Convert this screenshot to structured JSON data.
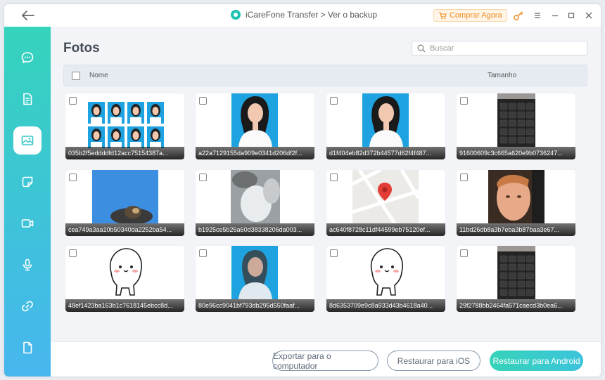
{
  "titlebar": {
    "title": "iCareFone Transfer > Ver o backup",
    "buy_label": "Comprar Agora"
  },
  "page": {
    "title": "Fotos"
  },
  "search": {
    "placeholder": "Buscar",
    "value": ""
  },
  "table": {
    "col_name": "Nome",
    "col_size": "Tamanho"
  },
  "sidebar": {
    "items": [
      {
        "name": "messages-icon"
      },
      {
        "name": "documents-icon"
      },
      {
        "name": "photos-icon",
        "active": true
      },
      {
        "name": "stickers-icon"
      },
      {
        "name": "video-icon"
      },
      {
        "name": "microphone-icon"
      },
      {
        "name": "link-icon"
      },
      {
        "name": "file-icon"
      }
    ]
  },
  "photos": [
    {
      "name": "035b2f5eddddfd12acc75154387a...",
      "kind": "passport-grid"
    },
    {
      "name": "a22a7129155da909e0341d206df2f...",
      "kind": "portrait"
    },
    {
      "name": "d1f404eb82d372b44577d62f4f487...",
      "kind": "portrait"
    },
    {
      "name": "91600609c3c665a620e9b0736247...",
      "kind": "keyboard"
    },
    {
      "name": "cea749a3aa10b50340da2252ba54...",
      "kind": "animal"
    },
    {
      "name": "b1925ce5b26a60d38338206da003...",
      "kind": "blur"
    },
    {
      "name": "ac640f8728c11df44599eb75120ef...",
      "kind": "map"
    },
    {
      "name": "11bd26db8a3b7eba3b87baa3e67...",
      "kind": "face"
    },
    {
      "name": "48ef1423ba163b1c7618145ebcc8d...",
      "kind": "sticker"
    },
    {
      "name": "80e96cc9041bf793db295d550faaf...",
      "kind": "portrait-blur"
    },
    {
      "name": "8d6353709e9c8a933d43b4618a40...",
      "kind": "sticker"
    },
    {
      "name": "29f2788bb2464fa571caecd3b0ea6...",
      "kind": "keyboard"
    }
  ],
  "footer": {
    "export_label": "Exportar para o computador",
    "ios_label": "Restaurar para iOS",
    "android_label": "Restaurar para Android"
  },
  "colors": {
    "accent": "#3ac9c8",
    "buy": "#f08a1c",
    "sidebar_top": "#35d3bb",
    "sidebar_bottom": "#47b6ee"
  }
}
